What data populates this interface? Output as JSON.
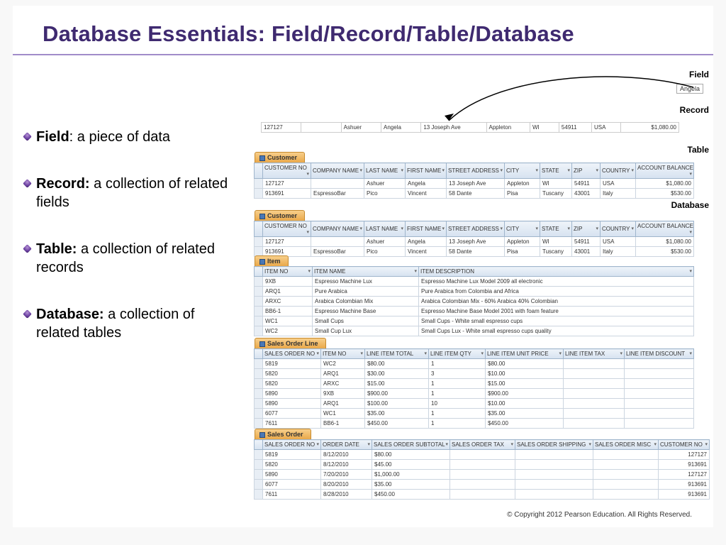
{
  "title": "Database Essentials: Field/Record/Table/Database",
  "bullets": [
    {
      "term": "Field",
      "sep": ": ",
      "def": "a piece of data"
    },
    {
      "term": "Record:",
      "sep": " ",
      "def": "a collection of related fields"
    },
    {
      "term": "Table:",
      "sep": " ",
      "def": "a collection of related records"
    },
    {
      "term": "Database:",
      "sep": " ",
      "def": "a collection of related tables"
    }
  ],
  "labels": {
    "field": "Field",
    "record": "Record",
    "table": "Table",
    "database": "Database"
  },
  "field_sample": "Angela",
  "record_row": [
    "127127",
    "",
    "Ashuer",
    "Angela",
    "13 Joseph Ave",
    "Appleton",
    "WI",
    "54911",
    "USA",
    "$1,080.00"
  ],
  "customer_headers": [
    "CUSTOMER NO",
    "COMPANY NAME",
    "LAST NAME",
    "FIRST NAME",
    "STREET ADDRESS",
    "CITY",
    "STATE",
    "ZIP",
    "COUNTRY",
    "ACCOUNT BALANCE"
  ],
  "customer_rows": [
    [
      "127127",
      "",
      "Ashuer",
      "Angela",
      "13 Joseph Ave",
      "Appleton",
      "WI",
      "54911",
      "USA",
      "$1,080.00"
    ],
    [
      "913691",
      "EspressoBar",
      "Pico",
      "Vincent",
      "58 Dante",
      "Pisa",
      "Tuscany",
      "43001",
      "Italy",
      "$530.00"
    ]
  ],
  "item_headers": [
    "ITEM NO",
    "ITEM NAME",
    "ITEM DESCRIPTION"
  ],
  "item_rows": [
    [
      "9XB",
      "Espresso Machine Lux",
      "Espresso Machine Lux Model 2009 all electronic"
    ],
    [
      "ARQ1",
      "Pure Arabica",
      "Pure Arabica from Colombia and Africa"
    ],
    [
      "ARXC",
      "Arabica Colombian Mix",
      "Arabica Colombian Mix - 60% Arabica 40% Colombian"
    ],
    [
      "BB6-1",
      "Espresso Machine Base",
      "Espresso Machine Base Model 2001 with foam feature"
    ],
    [
      "WC1",
      "Small Cups",
      "Small Cups - White small espresso cups"
    ],
    [
      "WC2",
      "Small Cup Lux",
      "Small Cups Lux - White small espresso cups quality"
    ]
  ],
  "sol_headers": [
    "SALES ORDER NO",
    "ITEM NO",
    "LINE ITEM TOTAL",
    "LINE ITEM QTY",
    "LINE ITEM UNIT PRICE",
    "LINE ITEM TAX",
    "LINE ITEM DISCOUNT"
  ],
  "sol_rows": [
    [
      "5819",
      "WC2",
      "$80.00",
      "1",
      "$80.00",
      "",
      ""
    ],
    [
      "5820",
      "ARQ1",
      "$30.00",
      "3",
      "$10.00",
      "",
      ""
    ],
    [
      "5820",
      "ARXC",
      "$15.00",
      "1",
      "$15.00",
      "",
      ""
    ],
    [
      "5890",
      "9XB",
      "$900.00",
      "1",
      "$900.00",
      "",
      ""
    ],
    [
      "5890",
      "ARQ1",
      "$100.00",
      "10",
      "$10.00",
      "",
      ""
    ],
    [
      "6077",
      "WC1",
      "$35.00",
      "1",
      "$35.00",
      "",
      ""
    ],
    [
      "7611",
      "BB6-1",
      "$450.00",
      "1",
      "$450.00",
      "",
      ""
    ]
  ],
  "so_headers": [
    "SALES ORDER NO",
    "ORDER DATE",
    "SALES ORDER SUBTOTAL",
    "SALES ORDER TAX",
    "SALES ORDER SHIPPING",
    "SALES ORDER MISC",
    "CUSTOMER NO"
  ],
  "so_rows": [
    [
      "5819",
      "8/12/2010",
      "$80.00",
      "",
      "",
      "",
      "127127"
    ],
    [
      "5820",
      "8/12/2010",
      "$45.00",
      "",
      "",
      "",
      "913691"
    ],
    [
      "5890",
      "7/20/2010",
      "$1,000.00",
      "",
      "",
      "",
      "127127"
    ],
    [
      "6077",
      "8/20/2010",
      "$35.00",
      "",
      "",
      "",
      "913691"
    ],
    [
      "7611",
      "8/28/2010",
      "$450.00",
      "",
      "",
      "",
      "913691"
    ]
  ],
  "tabs": {
    "customer": "Customer",
    "item": "Item",
    "sol": "Sales Order Line",
    "so": "Sales Order"
  },
  "copyright": "© Copyright 2012 Pearson Education. All Rights Reserved."
}
